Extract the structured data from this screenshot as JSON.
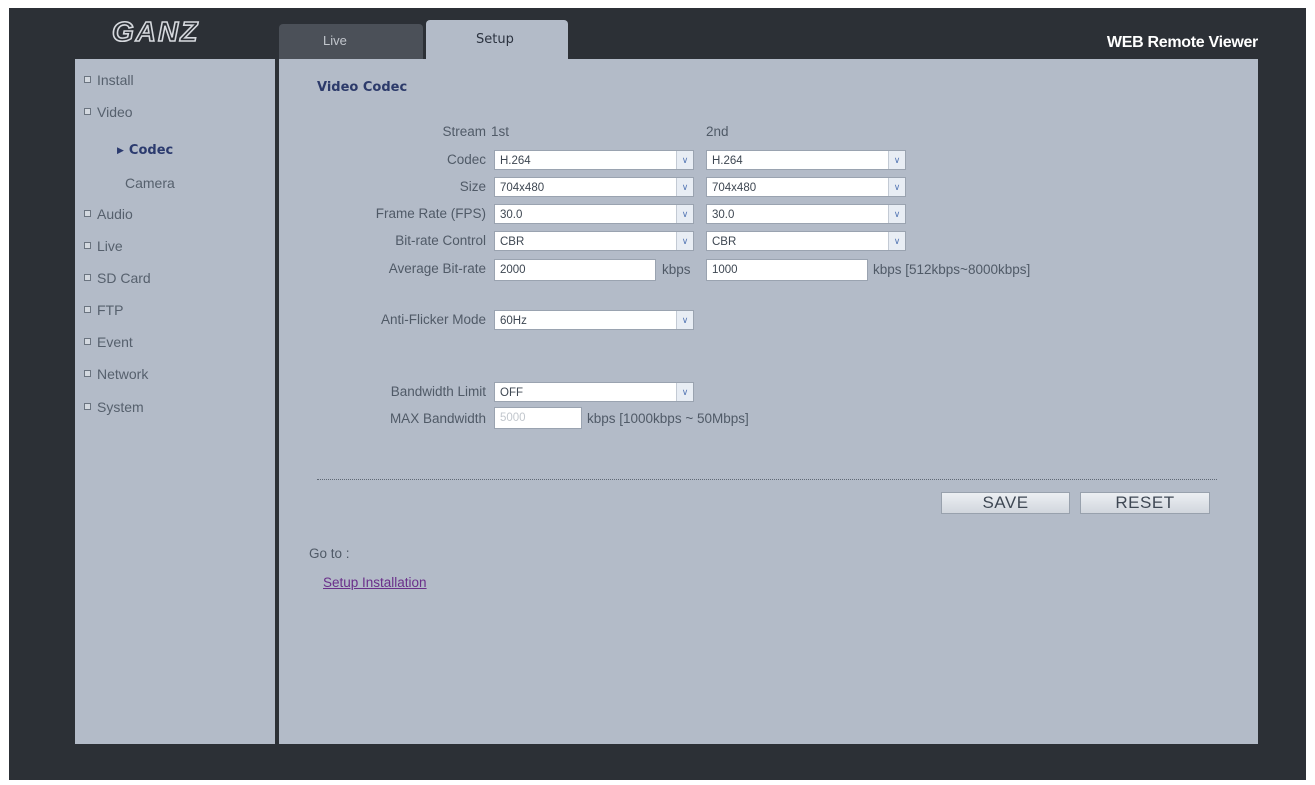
{
  "header": {
    "logo_text": "GANZ",
    "tabs": [
      {
        "label": "Live"
      },
      {
        "label": "Setup"
      }
    ],
    "viewer_title": "WEB Remote Viewer"
  },
  "sidebar": {
    "items": [
      {
        "label": "Install"
      },
      {
        "label": "Video"
      },
      {
        "label": "Audio"
      },
      {
        "label": "Live"
      },
      {
        "label": "SD Card"
      },
      {
        "label": "FTP"
      },
      {
        "label": "Event"
      },
      {
        "label": "Network"
      },
      {
        "label": "System"
      }
    ],
    "video_sub": [
      {
        "label": "Codec"
      },
      {
        "label": "Camera"
      }
    ]
  },
  "main": {
    "section_title": "Video Codec",
    "stream_label": "Stream",
    "stream_1_header": "1st",
    "stream_2_header": "2nd",
    "codec": {
      "label": "Codec",
      "value_1": "H.264",
      "value_2": "H.264"
    },
    "size": {
      "label": "Size",
      "value_1": "704x480",
      "value_2": "704x480"
    },
    "frame_rate": {
      "label": "Frame Rate (FPS)",
      "value_1": "30.0",
      "value_2": "30.0"
    },
    "bitrate_control": {
      "label": "Bit-rate Control",
      "value_1": "CBR",
      "value_2": "CBR"
    },
    "average_bitrate": {
      "label": "Average Bit-rate",
      "value_1": "2000",
      "unit_1": "kbps",
      "value_2": "1000",
      "unit_2": "kbps [512kbps~8000kbps]"
    },
    "anti_flicker": {
      "label": "Anti-Flicker Mode",
      "value": "60Hz"
    },
    "bandwidth_limit": {
      "label": "Bandwidth Limit",
      "value": "OFF"
    },
    "max_bandwidth": {
      "label": "MAX Bandwidth",
      "value": "5000",
      "unit": "kbps [1000kbps ~ 50Mbps]"
    },
    "save_label": "SAVE",
    "reset_label": "RESET",
    "goto_label": "Go to :",
    "setup_link": "Setup Installation"
  },
  "colors": {
    "frame_bg": "#2c3036",
    "panel_bg": "#b3bbc8",
    "active_nav": "#2b3a6e",
    "link": "#6a2f8a"
  }
}
